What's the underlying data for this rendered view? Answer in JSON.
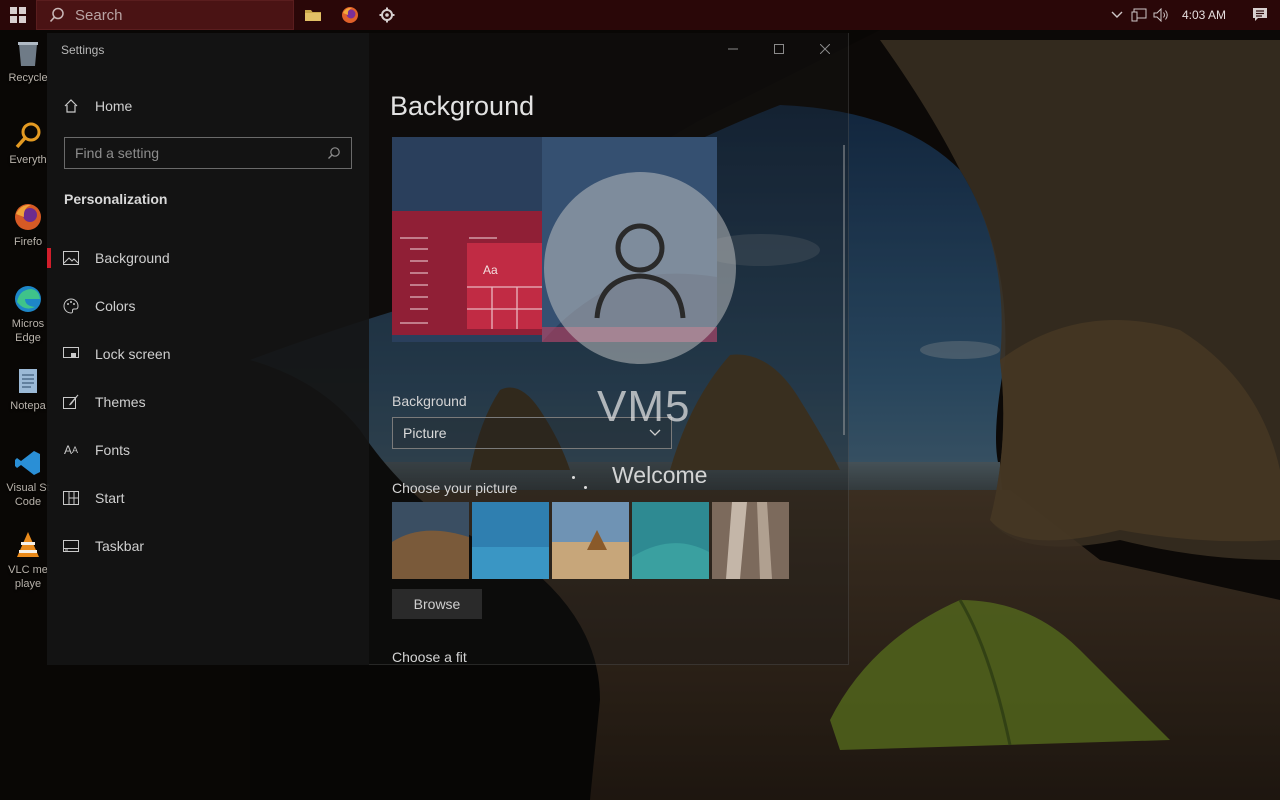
{
  "taskbar": {
    "search_placeholder": "Search",
    "clock": "4:03 AM",
    "pinned": [
      "file-explorer-icon",
      "firefox-icon",
      "settings-icon"
    ],
    "accent": "#2a0708"
  },
  "desktop_icons": [
    {
      "label": "Recycle",
      "icon": "recycle-bin-icon"
    },
    {
      "label": "Everyth",
      "icon": "everything-icon"
    },
    {
      "label": "Firefo",
      "icon": "firefox-icon"
    },
    {
      "label": "Micros Edge",
      "icon": "edge-icon"
    },
    {
      "label": "Notepa",
      "icon": "notepad-icon"
    },
    {
      "label": "Visual St Code",
      "icon": "vscode-icon"
    },
    {
      "label": "VLC me playe",
      "icon": "vlc-icon"
    }
  ],
  "settings": {
    "window_title": "Settings",
    "home": "Home",
    "find_placeholder": "Find a setting",
    "section": "Personalization",
    "nav_items": [
      {
        "label": "Background",
        "icon": "picture-icon",
        "active": true
      },
      {
        "label": "Colors",
        "icon": "palette-icon",
        "active": false
      },
      {
        "label": "Lock screen",
        "icon": "monitor-icon",
        "active": false
      },
      {
        "label": "Themes",
        "icon": "brush-icon",
        "active": false
      },
      {
        "label": "Fonts",
        "icon": "font-icon",
        "active": false
      },
      {
        "label": "Start",
        "icon": "start-grid-icon",
        "active": false
      },
      {
        "label": "Taskbar",
        "icon": "taskbar-icon",
        "active": false
      }
    ],
    "page_title": "Background",
    "preview_sample": "Aa",
    "background_label": "Background",
    "background_value": "Picture",
    "choose_picture_label": "Choose your picture",
    "browse_label": "Browse",
    "choose_fit_label": "Choose a fit",
    "accent": "#d11e2b"
  },
  "welcome_screen": {
    "user_name": "VM5",
    "status": "Welcome"
  }
}
